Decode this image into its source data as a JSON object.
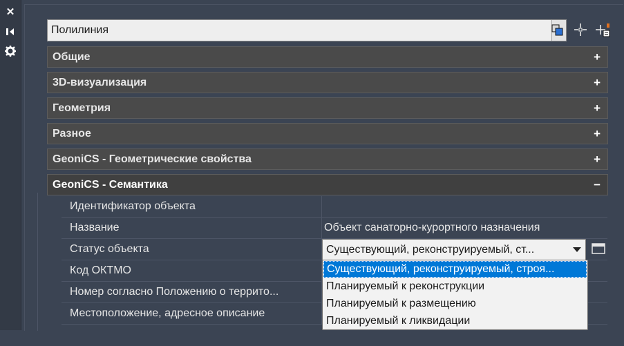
{
  "sidebar": {
    "icons": [
      "close-icon",
      "pin-icon",
      "settings-icon"
    ]
  },
  "object_type": {
    "value": "Полилиния",
    "tools": [
      "quick-select-icon",
      "select-objects-icon",
      "pickadd-toggle-icon"
    ]
  },
  "categories": [
    {
      "label": "Общие",
      "toggle": "+"
    },
    {
      "label": "3D-визуализация",
      "toggle": "+"
    },
    {
      "label": "Геометрия",
      "toggle": "+"
    },
    {
      "label": "Разное",
      "toggle": "+"
    },
    {
      "label": "GeoniCS - Геометрические свойства",
      "toggle": "+"
    },
    {
      "label": "GeoniCS - Семантика",
      "toggle": "−"
    }
  ],
  "properties": [
    {
      "name": "Идентификатор объекта",
      "value": ""
    },
    {
      "name": "Название",
      "value": "Объект санаторно-курортного назначения"
    },
    {
      "name": "Статус объекта",
      "value": ""
    },
    {
      "name": "Код ОКТМО",
      "value": ""
    },
    {
      "name": "Номер согласно Положению о террито...",
      "value": ""
    },
    {
      "name": "Местоположение, адресное описание",
      "value": ""
    }
  ],
  "status_combo": {
    "value": "Существующий,  реконструируемый,  ст..."
  },
  "status_options": [
    "Существующий,  реконструируемый,  строя...",
    "Планируемый к реконструкции",
    "Планируемый к размещению",
    "Планируемый к ликвидации"
  ],
  "colors": {
    "background": "#3b4453",
    "category_bg": "#4a4a4a",
    "selection": "#0078d7"
  }
}
